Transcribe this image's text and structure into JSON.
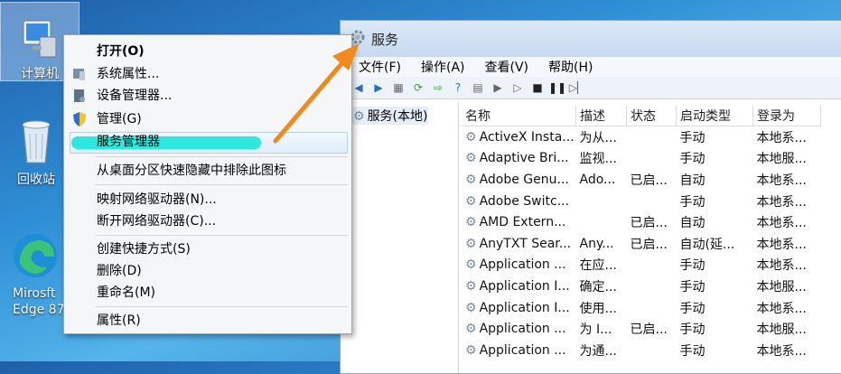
{
  "desktop": {
    "icons": [
      {
        "label": "计算机"
      },
      {
        "label": "回收站"
      },
      {
        "label_line1": "Mirosft",
        "label_line2": "Edge 87"
      }
    ]
  },
  "window": {
    "title": "服务",
    "menu": [
      "文件(F)",
      "操作(A)",
      "查看(V)",
      "帮助(H)"
    ],
    "tree_node": "服务(本地)",
    "columns": [
      "名称",
      "描述",
      "状态",
      "启动类型",
      "登录为"
    ],
    "rows": [
      [
        "ActiveX Insta...",
        "为从...",
        "",
        "手动",
        "本地系..."
      ],
      [
        "Adaptive Bri...",
        "监视...",
        "",
        "手动",
        "本地服..."
      ],
      [
        "Adobe Genu...",
        "Ado...",
        "已启...",
        "自动",
        "本地系..."
      ],
      [
        "Adobe Switc...",
        "",
        "",
        "手动",
        "本地系..."
      ],
      [
        "AMD Extern...",
        "",
        "已启...",
        "自动",
        "本地系..."
      ],
      [
        "AnyTXT Sear...",
        "Any...",
        "已启...",
        "自动(延...",
        "本地系..."
      ],
      [
        "Application ...",
        "在应...",
        "",
        "手动",
        "本地系..."
      ],
      [
        "Application I...",
        "确定...",
        "",
        "手动",
        "本地服..."
      ],
      [
        "Application I...",
        "使用...",
        "",
        "手动",
        "本地系..."
      ],
      [
        "Application ...",
        "为 I...",
        "已启...",
        "手动",
        "本地服..."
      ],
      [
        "Application ...",
        "为通...",
        "",
        "手动",
        "本地系..."
      ]
    ]
  },
  "context_menu": {
    "items": {
      "open": "打开(O)",
      "properties_sys": "系统属性...",
      "device_manager": "设备管理器...",
      "manage": "管理(G)",
      "service_manager": "服务管理器",
      "hide_icon": "从桌面分区快速隐藏中排除此图标",
      "map_drive": "映射网络驱动器(N)...",
      "disconnect_drive": "断开网络驱动器(C)...",
      "create_shortcut": "创建快捷方式(S)",
      "delete": "删除(D)",
      "rename": "重命名(M)",
      "properties": "属性(R)"
    }
  },
  "colors": {
    "arrow": "#f08a1e",
    "highlight_marker": "#2ee8e0"
  }
}
